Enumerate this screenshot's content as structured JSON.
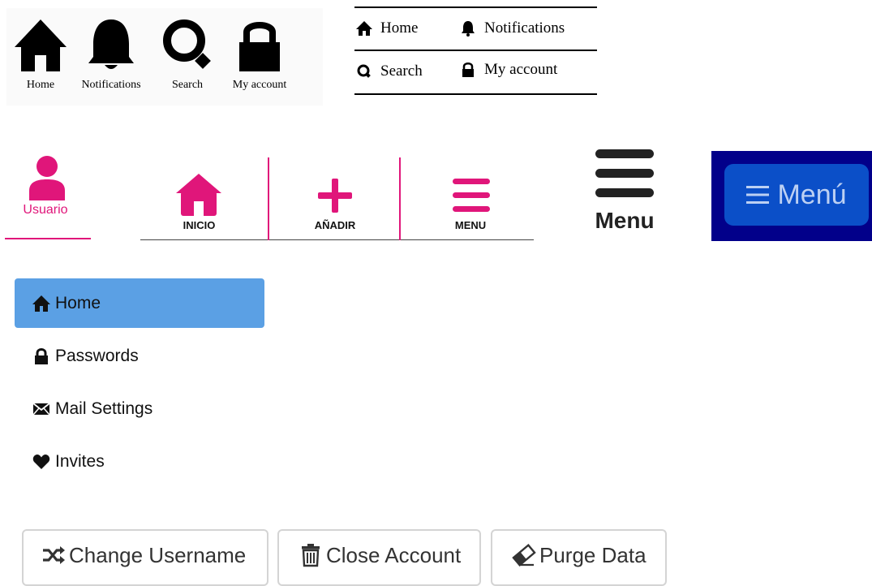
{
  "icon_nav": {
    "items": [
      {
        "label": "Home",
        "icon": "home-icon"
      },
      {
        "label": "Notifications",
        "icon": "bell-icon"
      },
      {
        "label": "Search",
        "icon": "search-icon"
      },
      {
        "label": "My account",
        "icon": "lock-icon"
      }
    ]
  },
  "list_nav": {
    "items": [
      {
        "label": "Home",
        "icon": "home-icon"
      },
      {
        "label": "Notifications",
        "icon": "bell-icon"
      },
      {
        "label": "Search",
        "icon": "search-icon"
      },
      {
        "label": "My account",
        "icon": "lock-icon"
      }
    ]
  },
  "pink_nav": {
    "user_label": "Usuario",
    "tabs": [
      {
        "label": "INICIO",
        "icon": "home-icon"
      },
      {
        "label": "AÑADIR",
        "icon": "plus-icon"
      },
      {
        "label": "MENU",
        "icon": "hamburger-icon"
      }
    ],
    "accent": "#e0167a"
  },
  "menu_icon": {
    "label": "Menu",
    "icon": "hamburger-icon"
  },
  "blue_menu": {
    "label": "Menú",
    "icon": "hamburger-icon",
    "background": "#02008a",
    "button_color": "#0b4fc8"
  },
  "sidebar": {
    "items": [
      {
        "label": "Home",
        "icon": "home-icon",
        "active": true
      },
      {
        "label": "Passwords",
        "icon": "lock-icon",
        "active": false
      },
      {
        "label": "Mail Settings",
        "icon": "envelope-icon",
        "active": false
      },
      {
        "label": "Invites",
        "icon": "heart-icon",
        "active": false
      }
    ],
    "active_color": "#5ba0e4"
  },
  "actions": [
    {
      "label": "Change Username",
      "icon": "shuffle-icon"
    },
    {
      "label": "Close Account",
      "icon": "trash-icon"
    },
    {
      "label": "Purge Data",
      "icon": "eraser-icon"
    }
  ]
}
